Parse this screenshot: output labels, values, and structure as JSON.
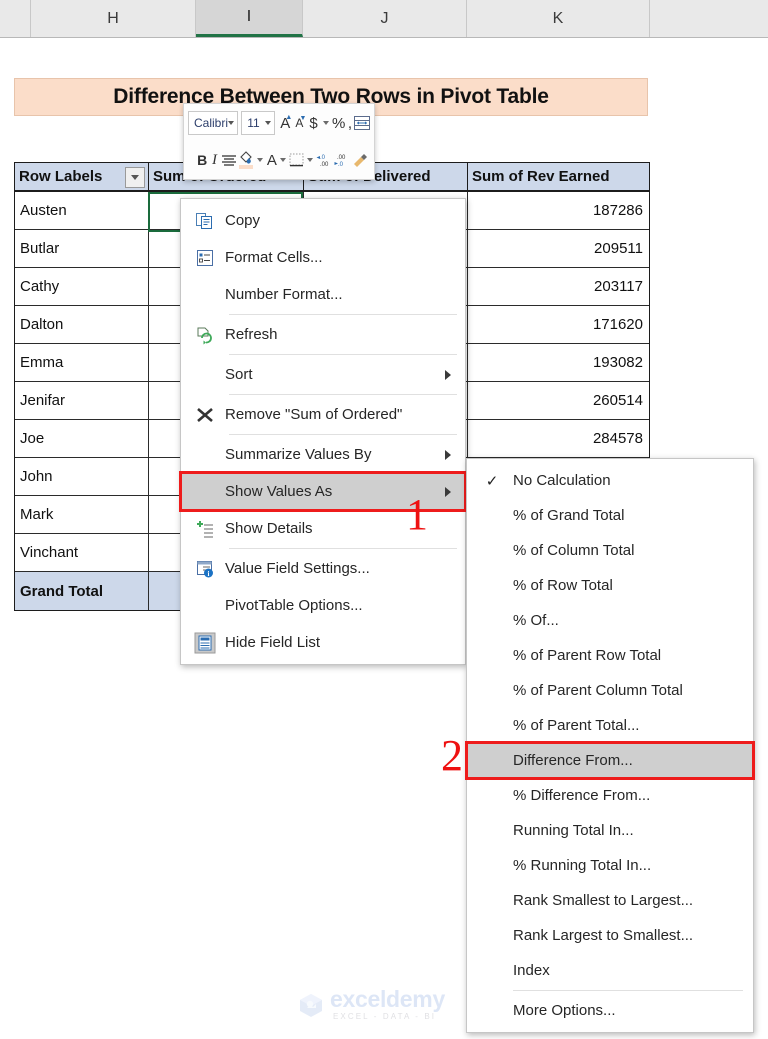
{
  "spreadsheet": {
    "column_headers": [
      {
        "label": "H",
        "selected": false
      },
      {
        "label": "I",
        "selected": true
      },
      {
        "label": "J",
        "selected": false
      },
      {
        "label": "K",
        "selected": false
      }
    ],
    "title_banner": "Difference Between Two Rows in Pivot Table",
    "pivot": {
      "headers": [
        "Row Labels",
        "Sum of Ordered",
        "Sum of Delivered",
        "Sum of Rev Earned"
      ],
      "rows": [
        {
          "label": "Austen",
          "ordered": "",
          "delivered": "",
          "rev": "187286"
        },
        {
          "label": "Butlar",
          "ordered": "",
          "delivered": "",
          "rev": "209511"
        },
        {
          "label": "Cathy",
          "ordered": "",
          "delivered": "",
          "rev": "203117"
        },
        {
          "label": "Dalton",
          "ordered": "",
          "delivered": "",
          "rev": "171620"
        },
        {
          "label": "Emma",
          "ordered": "",
          "delivered": "",
          "rev": "193082"
        },
        {
          "label": "Jenifar",
          "ordered": "",
          "delivered": "",
          "rev": "260514"
        },
        {
          "label": "Joe",
          "ordered": "",
          "delivered": "",
          "rev": "284578"
        },
        {
          "label": "John",
          "ordered": "",
          "delivered": "",
          "rev": ""
        },
        {
          "label": "Mark",
          "ordered": "",
          "delivered": "",
          "rev": ""
        },
        {
          "label": "Vinchant",
          "ordered": "",
          "delivered": "",
          "rev": ""
        },
        {
          "label": "Grand Total",
          "ordered": "",
          "delivered": "",
          "rev": ""
        }
      ]
    }
  },
  "mini_toolbar": {
    "font_name": "Calibri",
    "font_size": "11",
    "buttons": [
      "increase-font-size",
      "decrease-font-size",
      "accounting-number-format",
      "percent-style",
      "comma-style",
      "format-cells",
      "bold",
      "italic",
      "center-align",
      "fill-color",
      "font-color",
      "borders",
      "decrease-decimal",
      "increase-decimal",
      "format-painter"
    ]
  },
  "context_menu": {
    "items": [
      {
        "label": "Copy",
        "icon": "copy-icon",
        "submenu": false,
        "sep_after": false
      },
      {
        "label": "Format Cells...",
        "icon": "format-cells-icon",
        "submenu": false,
        "sep_after": false
      },
      {
        "label": "Number Format...",
        "icon": "",
        "submenu": false,
        "sep_after": true
      },
      {
        "label": "Refresh",
        "icon": "refresh-icon",
        "submenu": false,
        "sep_after": true
      },
      {
        "label": "Sort",
        "icon": "",
        "submenu": true,
        "sep_after": true
      },
      {
        "label": "Remove \"Sum of Ordered\"",
        "icon": "remove-x-icon",
        "submenu": false,
        "sep_after": true
      },
      {
        "label": "Summarize Values By",
        "icon": "",
        "submenu": true,
        "sep_after": false
      },
      {
        "label": "Show Values As",
        "icon": "",
        "submenu": true,
        "sep_after": false,
        "highlighted": true
      },
      {
        "label": "Show Details",
        "icon": "show-details-icon",
        "submenu": false,
        "sep_after": true
      },
      {
        "label": "Value Field Settings...",
        "icon": "value-field-settings-icon",
        "submenu": false,
        "sep_after": false
      },
      {
        "label": "PivotTable Options...",
        "icon": "",
        "submenu": false,
        "sep_after": false
      },
      {
        "label": "Hide Field List",
        "icon": "hide-field-list-icon",
        "submenu": false,
        "sep_after": false
      }
    ]
  },
  "show_values_as_submenu": {
    "items": [
      {
        "label": "No Calculation",
        "checked": true
      },
      {
        "label": "% of Grand Total",
        "checked": false
      },
      {
        "label": "% of Column Total",
        "checked": false
      },
      {
        "label": "% of Row Total",
        "checked": false
      },
      {
        "label": "% Of...",
        "checked": false
      },
      {
        "label": "% of Parent Row Total",
        "checked": false
      },
      {
        "label": "% of Parent Column Total",
        "checked": false
      },
      {
        "label": "% of Parent Total...",
        "checked": false
      },
      {
        "label": "Difference From...",
        "checked": false,
        "highlighted": true
      },
      {
        "label": "% Difference From...",
        "checked": false
      },
      {
        "label": "Running Total In...",
        "checked": false
      },
      {
        "label": "% Running Total In...",
        "checked": false
      },
      {
        "label": "Rank Smallest to Largest...",
        "checked": false
      },
      {
        "label": "Rank Largest to Smallest...",
        "checked": false
      },
      {
        "label": "Index",
        "checked": false,
        "sep_after": true
      },
      {
        "label": "More Options...",
        "checked": false
      }
    ]
  },
  "annotations": [
    {
      "id": "1",
      "text": "1"
    },
    {
      "id": "2",
      "text": "2"
    }
  ],
  "watermark": {
    "name": "exceldemy",
    "tagline": "EXCEL - DATA - BI"
  },
  "colors": {
    "accent_green": "#217346",
    "annotation_red": "#ee1111",
    "header_blue": "#cdd8ea",
    "title_peach": "#fbddc9",
    "highlight_grey": "#cfcfcf"
  }
}
